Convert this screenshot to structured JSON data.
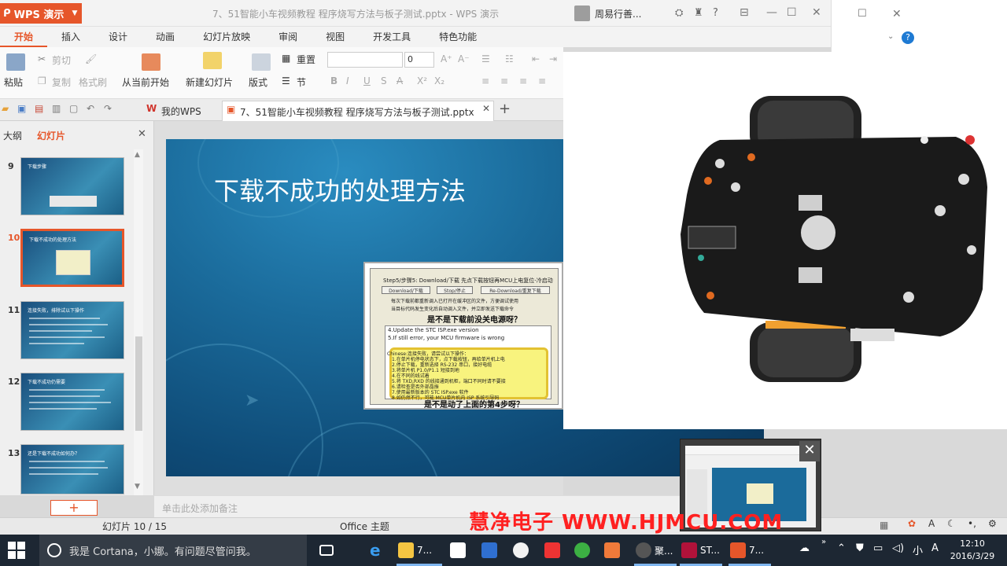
{
  "app": {
    "button_label": "WPS 演示",
    "doc_title": "7、51智能小车视频教程 程序烧写方法与板子测试.pptx - WPS 演示",
    "user_label": "周易行善..."
  },
  "ribbon_tabs": [
    "开始",
    "插入",
    "设计",
    "动画",
    "幻灯片放映",
    "审阅",
    "视图",
    "开发工具",
    "特色功能"
  ],
  "ribbon": {
    "paste": "粘贴",
    "cut": "剪切",
    "copy": "复制",
    "format_painter": "格式刷",
    "from_current": "从当前开始",
    "new_slide": "新建幻灯片",
    "layout": "版式",
    "reset": "重置",
    "section": "节",
    "font_size": "0"
  },
  "doc_tabs": {
    "my_wps": "我的WPS",
    "active_file": "7、51智能小车视频教程 程序烧写方法与板子测试.pptx"
  },
  "left_panel": {
    "tab_outline": "大纲",
    "tab_slides": "幻灯片",
    "slides": [
      {
        "num": "9",
        "title": "下载步骤"
      },
      {
        "num": "10",
        "title": "下载不成功的处理方法"
      },
      {
        "num": "11",
        "title": "连接失败，排除试以下操作"
      },
      {
        "num": "12",
        "title": "下载不成功仍需要"
      },
      {
        "num": "13",
        "title": "还是下载不成功如何办？"
      }
    ]
  },
  "slide": {
    "title": "下载不成功的处理方法",
    "dialog": {
      "header": "Step5/步骤5: Download/下载   先点下载按钮再MCU上电复位-冷启动",
      "btn_download": "Download/下载",
      "btn_stop": "Stop/停止",
      "btn_redownload": "Re-Download/重复下载",
      "check1": "每次下载前都重新调入已打开在缓冲区的文件，方便调试使用",
      "check2": "当目标代码发生变化后自动调入文件，并立即发送下载命令",
      "question1": "是不是下载前没关电源呀？",
      "log1": "4.Update the STC ISP.exe version",
      "log2": "5.If still error, your MCU firmware is wrong",
      "yellow_lines": [
        "Chinese:连接失败，请尝试以下操作：",
        "1.在单片机停电状态下，点下载按钮，再给单片机上电",
        "2.停止下载，重新选择 RS-232 串口，接好电缆",
        "3.将单片机 P1.0/P1.1 短接到地",
        "4.在不同的线试着",
        "5.将 TXD,RXD 的线接通到机柜，端口不同时请不要接",
        "6.请检查是否外部晶振",
        "7.使用最新版本的 STC ISP.exe 软件",
        "8.如仍然不行，可能 MCU单片机内 ISP 系统引导码"
      ],
      "question2": "是不是动了上面的第4步呀？"
    }
  },
  "notes_placeholder": "单击此处添加备注",
  "status": {
    "slide_counter": "幻灯片 10 / 15",
    "theme": "Office 主题"
  },
  "watermark": "慧净电子 WWW.HJMCU.COM",
  "taskbar": {
    "cortana_text": "我是 Cortana，小娜。有问题尽管问我。",
    "items": [
      {
        "label": "7...",
        "icon": "folder-icon"
      },
      {
        "label": "聚...",
        "icon": "media-icon"
      },
      {
        "label": "ST...",
        "icon": "stc-icon"
      },
      {
        "label": "7...",
        "icon": "wps-presentation-icon"
      }
    ],
    "time": "12:10",
    "date": "2016/3/29",
    "ime": "A"
  },
  "colors": {
    "accent": "#e6562a",
    "slide_bg": "#1a6a9a",
    "watermark": "#ff2020",
    "taskbar": "#1d2733"
  }
}
